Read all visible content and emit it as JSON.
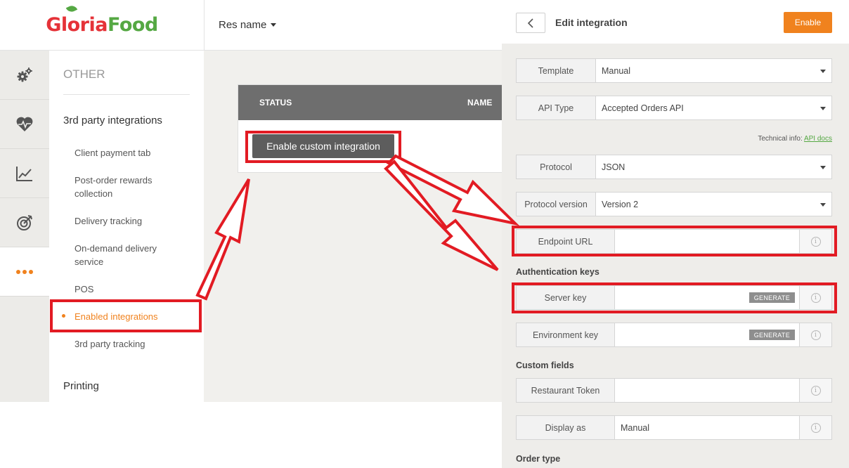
{
  "brand": {
    "part1": "Gloria",
    "part2": "Food",
    "colors": {
      "red": "#e53238",
      "green": "#55a843"
    }
  },
  "topbar": {
    "restaurant_name": "Res name"
  },
  "icon_sidebar": {
    "items": [
      {
        "icon": "gears-icon"
      },
      {
        "icon": "heart-pulse-icon"
      },
      {
        "icon": "chart-icon"
      },
      {
        "icon": "target-icon"
      },
      {
        "icon": "more-dots-icon",
        "active": true
      }
    ]
  },
  "menu": {
    "section": "OTHER",
    "group1": "3rd party integrations",
    "items": [
      {
        "label": "Client payment tab"
      },
      {
        "label": "Post-order rewards collection"
      },
      {
        "label": "Delivery tracking"
      },
      {
        "label": "On-demand delivery service"
      },
      {
        "label": "POS"
      },
      {
        "label": "Enabled integrations",
        "active": true
      },
      {
        "label": "3rd party tracking"
      }
    ],
    "group2": "Printing"
  },
  "table": {
    "headers": {
      "status": "STATUS",
      "name": "NAME"
    },
    "button": "Enable custom integration"
  },
  "panel": {
    "title": "Edit integration",
    "enable_button": "Enable",
    "fields": {
      "template": {
        "label": "Template",
        "value": "Manual"
      },
      "api_type": {
        "label": "API Type",
        "value": "Accepted Orders API"
      },
      "protocol": {
        "label": "Protocol",
        "value": "JSON"
      },
      "protocol_version": {
        "label": "Protocol version",
        "value": "Version 2"
      },
      "endpoint_url": {
        "label": "Endpoint URL",
        "value": ""
      },
      "server_key": {
        "label": "Server key",
        "value": "",
        "button": "GENERATE"
      },
      "environment_key": {
        "label": "Environment key",
        "value": "",
        "button": "GENERATE"
      },
      "restaurant_token": {
        "label": "Restaurant Token",
        "value": ""
      },
      "display_as": {
        "label": "Display as",
        "value": "Manual"
      }
    },
    "tech_info": {
      "prefix": "Technical info:",
      "link": "API docs"
    },
    "sections": {
      "auth_keys": "Authentication keys",
      "custom_fields": "Custom fields",
      "order_type": "Order type"
    },
    "info_glyph": "i"
  },
  "accent_colors": {
    "orange": "#f0821e",
    "highlight_red": "#e21b23"
  }
}
